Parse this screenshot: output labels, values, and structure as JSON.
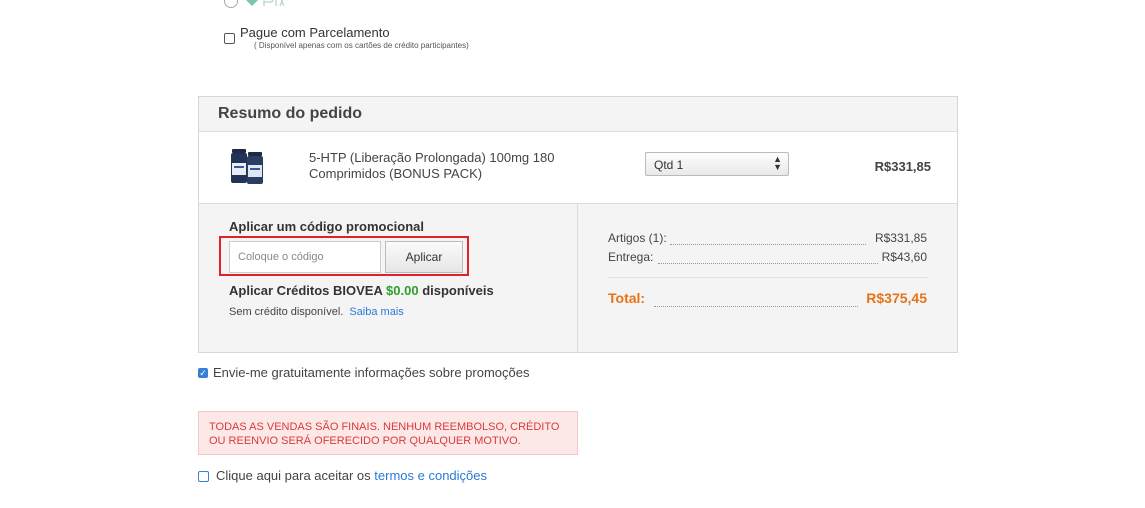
{
  "payment": {
    "installment_label": "Pague com Parcelamento",
    "installment_note": "( Disponível apenas com os cartões de crédito participantes)"
  },
  "summary": {
    "title": "Resumo do pedido",
    "product": {
      "name": "5-HTP (Liberação Prolongada) 100mg 180 Comprimidos (BONUS PACK)",
      "qty_label": "Qtd 1",
      "price": "R$331,85"
    },
    "promo": {
      "title": "Aplicar um código promocional",
      "placeholder": "Coloque o código",
      "apply_label": "Aplicar"
    },
    "credits": {
      "prefix": "Aplicar Créditos BIOVEA",
      "amount": "$0.00",
      "suffix": "disponíveis",
      "none_text": "Sem crédito disponível.",
      "learn_more": "Saiba mais"
    },
    "totals": {
      "items_label": "Artigos (1):",
      "items_value": "R$331,85",
      "shipping_label": "Entrega:",
      "shipping_value": "R$43,60",
      "total_label": "Total:",
      "total_value": "R$375,45"
    }
  },
  "newsletter": {
    "label": "Envie-me gratuitamente informações sobre promoções",
    "checked": true
  },
  "warning": {
    "text": "TODAS AS VENDAS SÃO FINAIS. NENHUM REEMBOLSO, CRÉDITO OU REENVIO SERÁ OFERECIDO POR QUALQUER MOTIVO."
  },
  "terms": {
    "prefix": "Clique aqui para aceitar os",
    "link": "termos e condições"
  },
  "colors": {
    "accent_total": "#e87316",
    "link": "#2a7ad8",
    "warning_text": "#d93a3a",
    "credit_amount": "#2ca02c",
    "highlight_border": "#e0212a"
  }
}
